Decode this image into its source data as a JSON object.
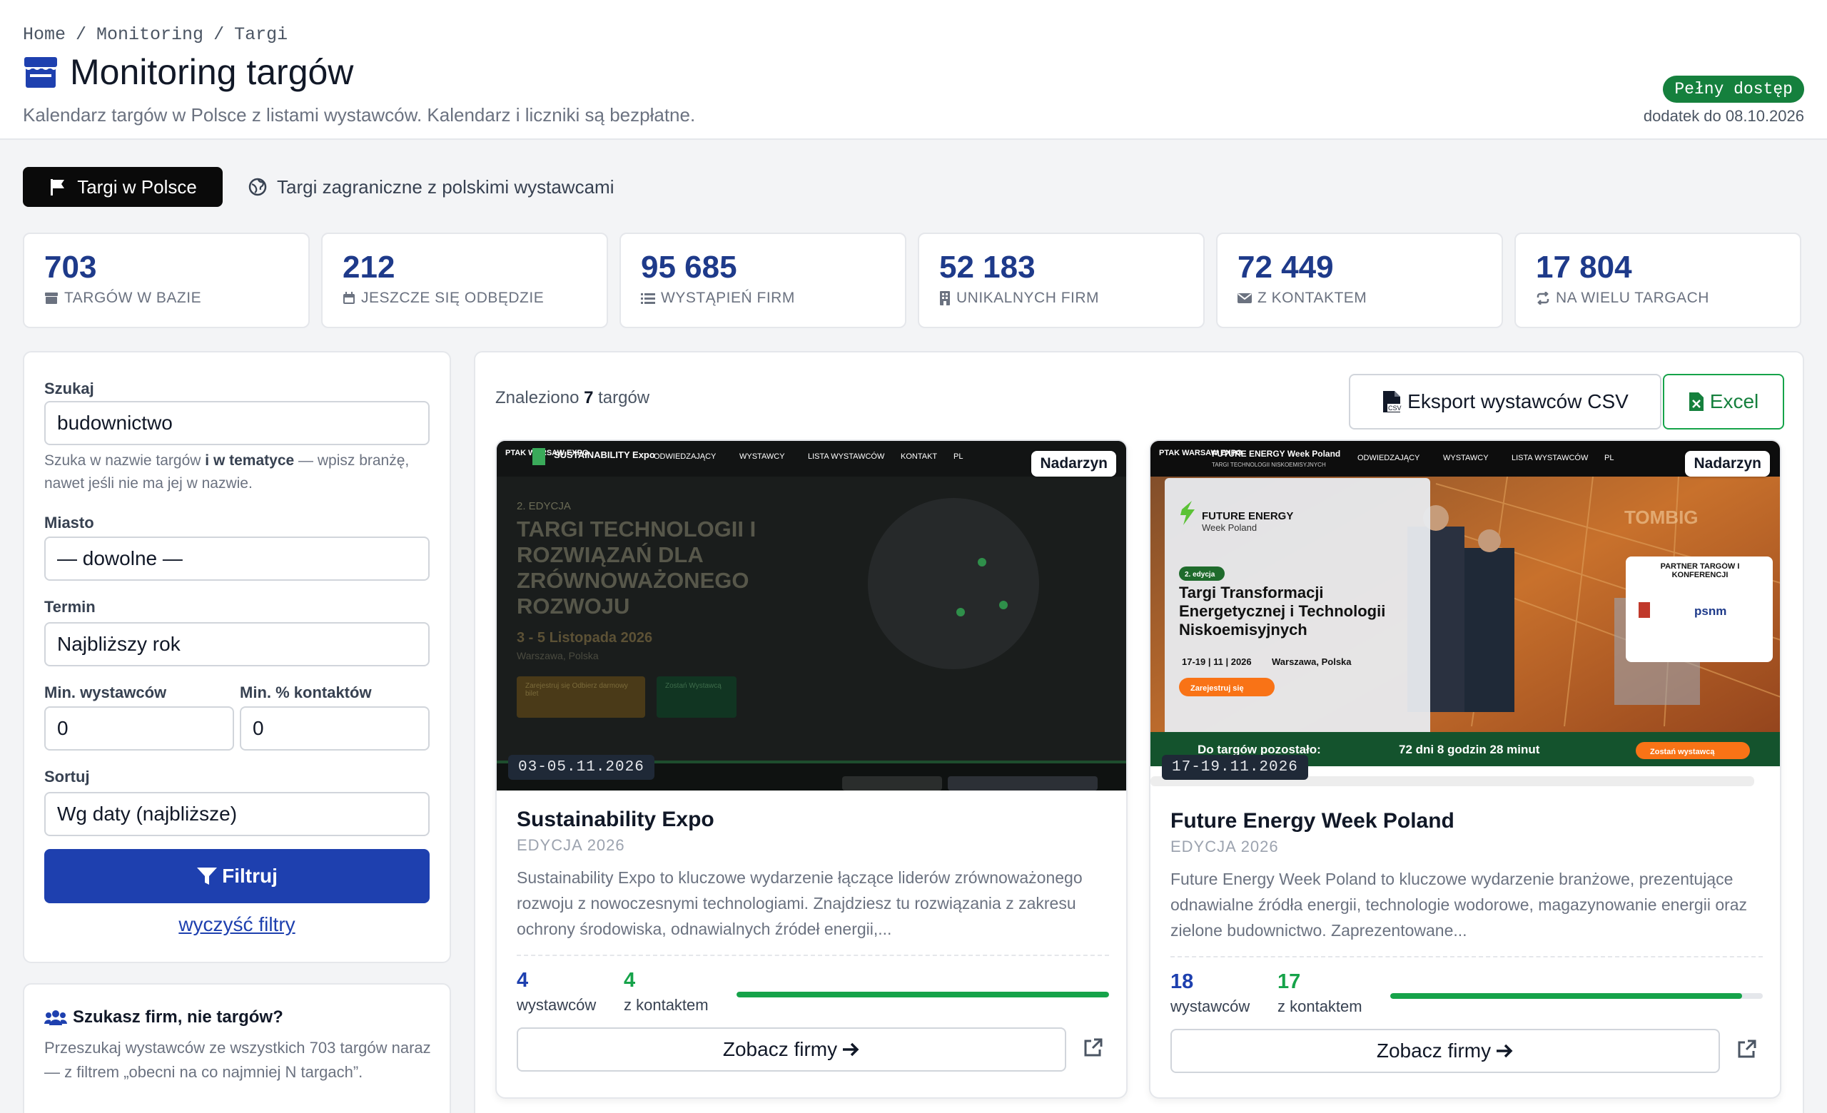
{
  "breadcrumb": {
    "home": "Home",
    "monitoring": "Monitoring",
    "current": "Targi",
    "separator": "/"
  },
  "header": {
    "title": "Monitoring targów",
    "subtitle": "Kalendarz targów w Polsce z listami wystawców. Kalendarz i liczniki są bezpłatne.",
    "access_badge": "Pełny dostęp",
    "addon_until": "dodatek do 08.10.2026"
  },
  "tabs": {
    "active": "Targi w Polsce",
    "other": "Targi zagraniczne z polskimi wystawcami"
  },
  "stats": [
    {
      "value": "703",
      "label": "TARGÓW W BAZIE",
      "icon": "store-icon"
    },
    {
      "value": "212",
      "label": "JESZCZE SIĘ ODBĘDZIE",
      "icon": "calendar-icon"
    },
    {
      "value": "95 685",
      "label": "WYSTĄPIEŃ FIRM",
      "icon": "list-icon"
    },
    {
      "value": "52 183",
      "label": "UNIKALNYCH FIRM",
      "icon": "building-icon"
    },
    {
      "value": "72 449",
      "label": "Z KONTAKTEM",
      "icon": "envelope-icon"
    },
    {
      "value": "17 804",
      "label": "NA WIELU TARGACH",
      "icon": "repeat-icon"
    }
  ],
  "filters": {
    "search_label": "Szukaj",
    "search_value": "budownictwo",
    "search_hint_1": "Szuka w nazwie targów ",
    "search_hint_bold": "i w tematyce",
    "search_hint_2": " — wpisz branżę, nawet jeśli nie ma jej w nazwie.",
    "city_label": "Miasto",
    "city_value": "— dowolne —",
    "term_label": "Termin",
    "term_value": "Najbliższy rok",
    "min_exhibitors_label": "Min. wystawców",
    "min_exhibitors_value": "0",
    "min_contacts_label": "Min. % kontaktów",
    "min_contacts_value": "0",
    "sort_label": "Sortuj",
    "sort_value": "Wg daty (najbliższe)",
    "filter_button": "Filtruj",
    "clear_link": "wyczyść filtry"
  },
  "promo": {
    "title": "Szukasz firm, nie targów?",
    "text": "Przeszukaj wystawców ze wszystkich 703 targów naraz — z filtrem „obecni na co najmniej N targach”."
  },
  "results": {
    "found_prefix": "Znaleziono ",
    "found_count": "7",
    "found_suffix": " targów",
    "export_csv": "Eksport wystawców CSV",
    "export_excel": "Excel"
  },
  "cards": [
    {
      "badge": "Nadarzyn",
      "date": "03-05.11.2026",
      "name": "Sustainability Expo",
      "edition": "EDYCJA 2026",
      "description": "Sustainability Expo to kluczowe wydarzenie łączące liderów zrównoważonego rozwoju z nowoczesnymi technologiami. Znajdziesz tu rozwiązania z zakresu ochrony środowiska, odnawialnych źródeł energii,...",
      "exhibitors": "4",
      "exhibitors_label": "wystawców",
      "contacts": "4",
      "contacts_label": "z kontaktem",
      "contact_ratio": 1.0,
      "button": "Zobacz firmy",
      "banner": {
        "logo_top": "PTAK WARSAW EXPO",
        "logo_brand": "SUSTAINABILITY Expo",
        "nav": [
          "ODWIEDZAJĄCY",
          "WYSTAWCY",
          "LISTA WYSTAWCÓW",
          "KONTAKT",
          "PL"
        ],
        "edition": "2. EDYCJA",
        "headline": "TARGI TECHNOLOGII I ROZWIĄZAŃ DLA ZRÓWNOWAŻONEGO ROZWOJU",
        "dates": "3 - 5 Listopada 2026",
        "place": "Warszawa, Polska",
        "cta1": "Zarejestruj się Odbierz darmowy bilet",
        "cta2": "Zostań Wystawcą"
      }
    },
    {
      "badge": "Nadarzyn",
      "date": "17-19.11.2026",
      "name": "Future Energy Week Poland",
      "edition": "EDYCJA 2026",
      "description": "Future Energy Week Poland to kluczowe wydarzenie branżowe, prezentujące odnawialne źródła energii, technologie wodorowe, magazynowanie energii oraz zielone budownictwo. Zaprezentowane...",
      "exhibitors": "18",
      "exhibitors_label": "wystawców",
      "contacts": "17",
      "contacts_label": "z kontaktem",
      "contact_ratio": 0.944,
      "button": "Zobacz firmy",
      "banner": {
        "logo_top": "PTAK WARSAW EXPO",
        "logo_brand": "FUTURE ENERGY Week Poland",
        "logo_sub": "TARGI TECHNOLOGII NISKOEMISYJNYCH",
        "nav": [
          "ODWIEDZAJĄCY",
          "WYSTAWCY",
          "LISTA WYSTAWCÓW",
          "PL"
        ],
        "panel_brand_1": "FUTURE ENERGY",
        "panel_brand_2": "Week Poland",
        "panel_edition": "2. edycja",
        "panel_headline": "Targi Transformacji Energetycznej i Technologii Niskoemisyjnych",
        "panel_dates": "17-19 | 11 | 2026",
        "panel_place": "Warszawa, Polska",
        "panel_cta": "Zarejestruj się",
        "partner_title": "PARTNER TARGÓW I KONFERENCJI",
        "partner_logo": "psnm",
        "stand_text": "TOMBIG",
        "countdown_label": "Do targów pozostało:",
        "countdown_value": "72 dni 8 godzin 28 minut",
        "countdown_cta": "Zostań wystawcą"
      }
    }
  ],
  "colors": {
    "accent": "#1e40af",
    "stat_number": "#1e3a8a",
    "success": "#16a34a",
    "badge_green": "#15803d"
  }
}
